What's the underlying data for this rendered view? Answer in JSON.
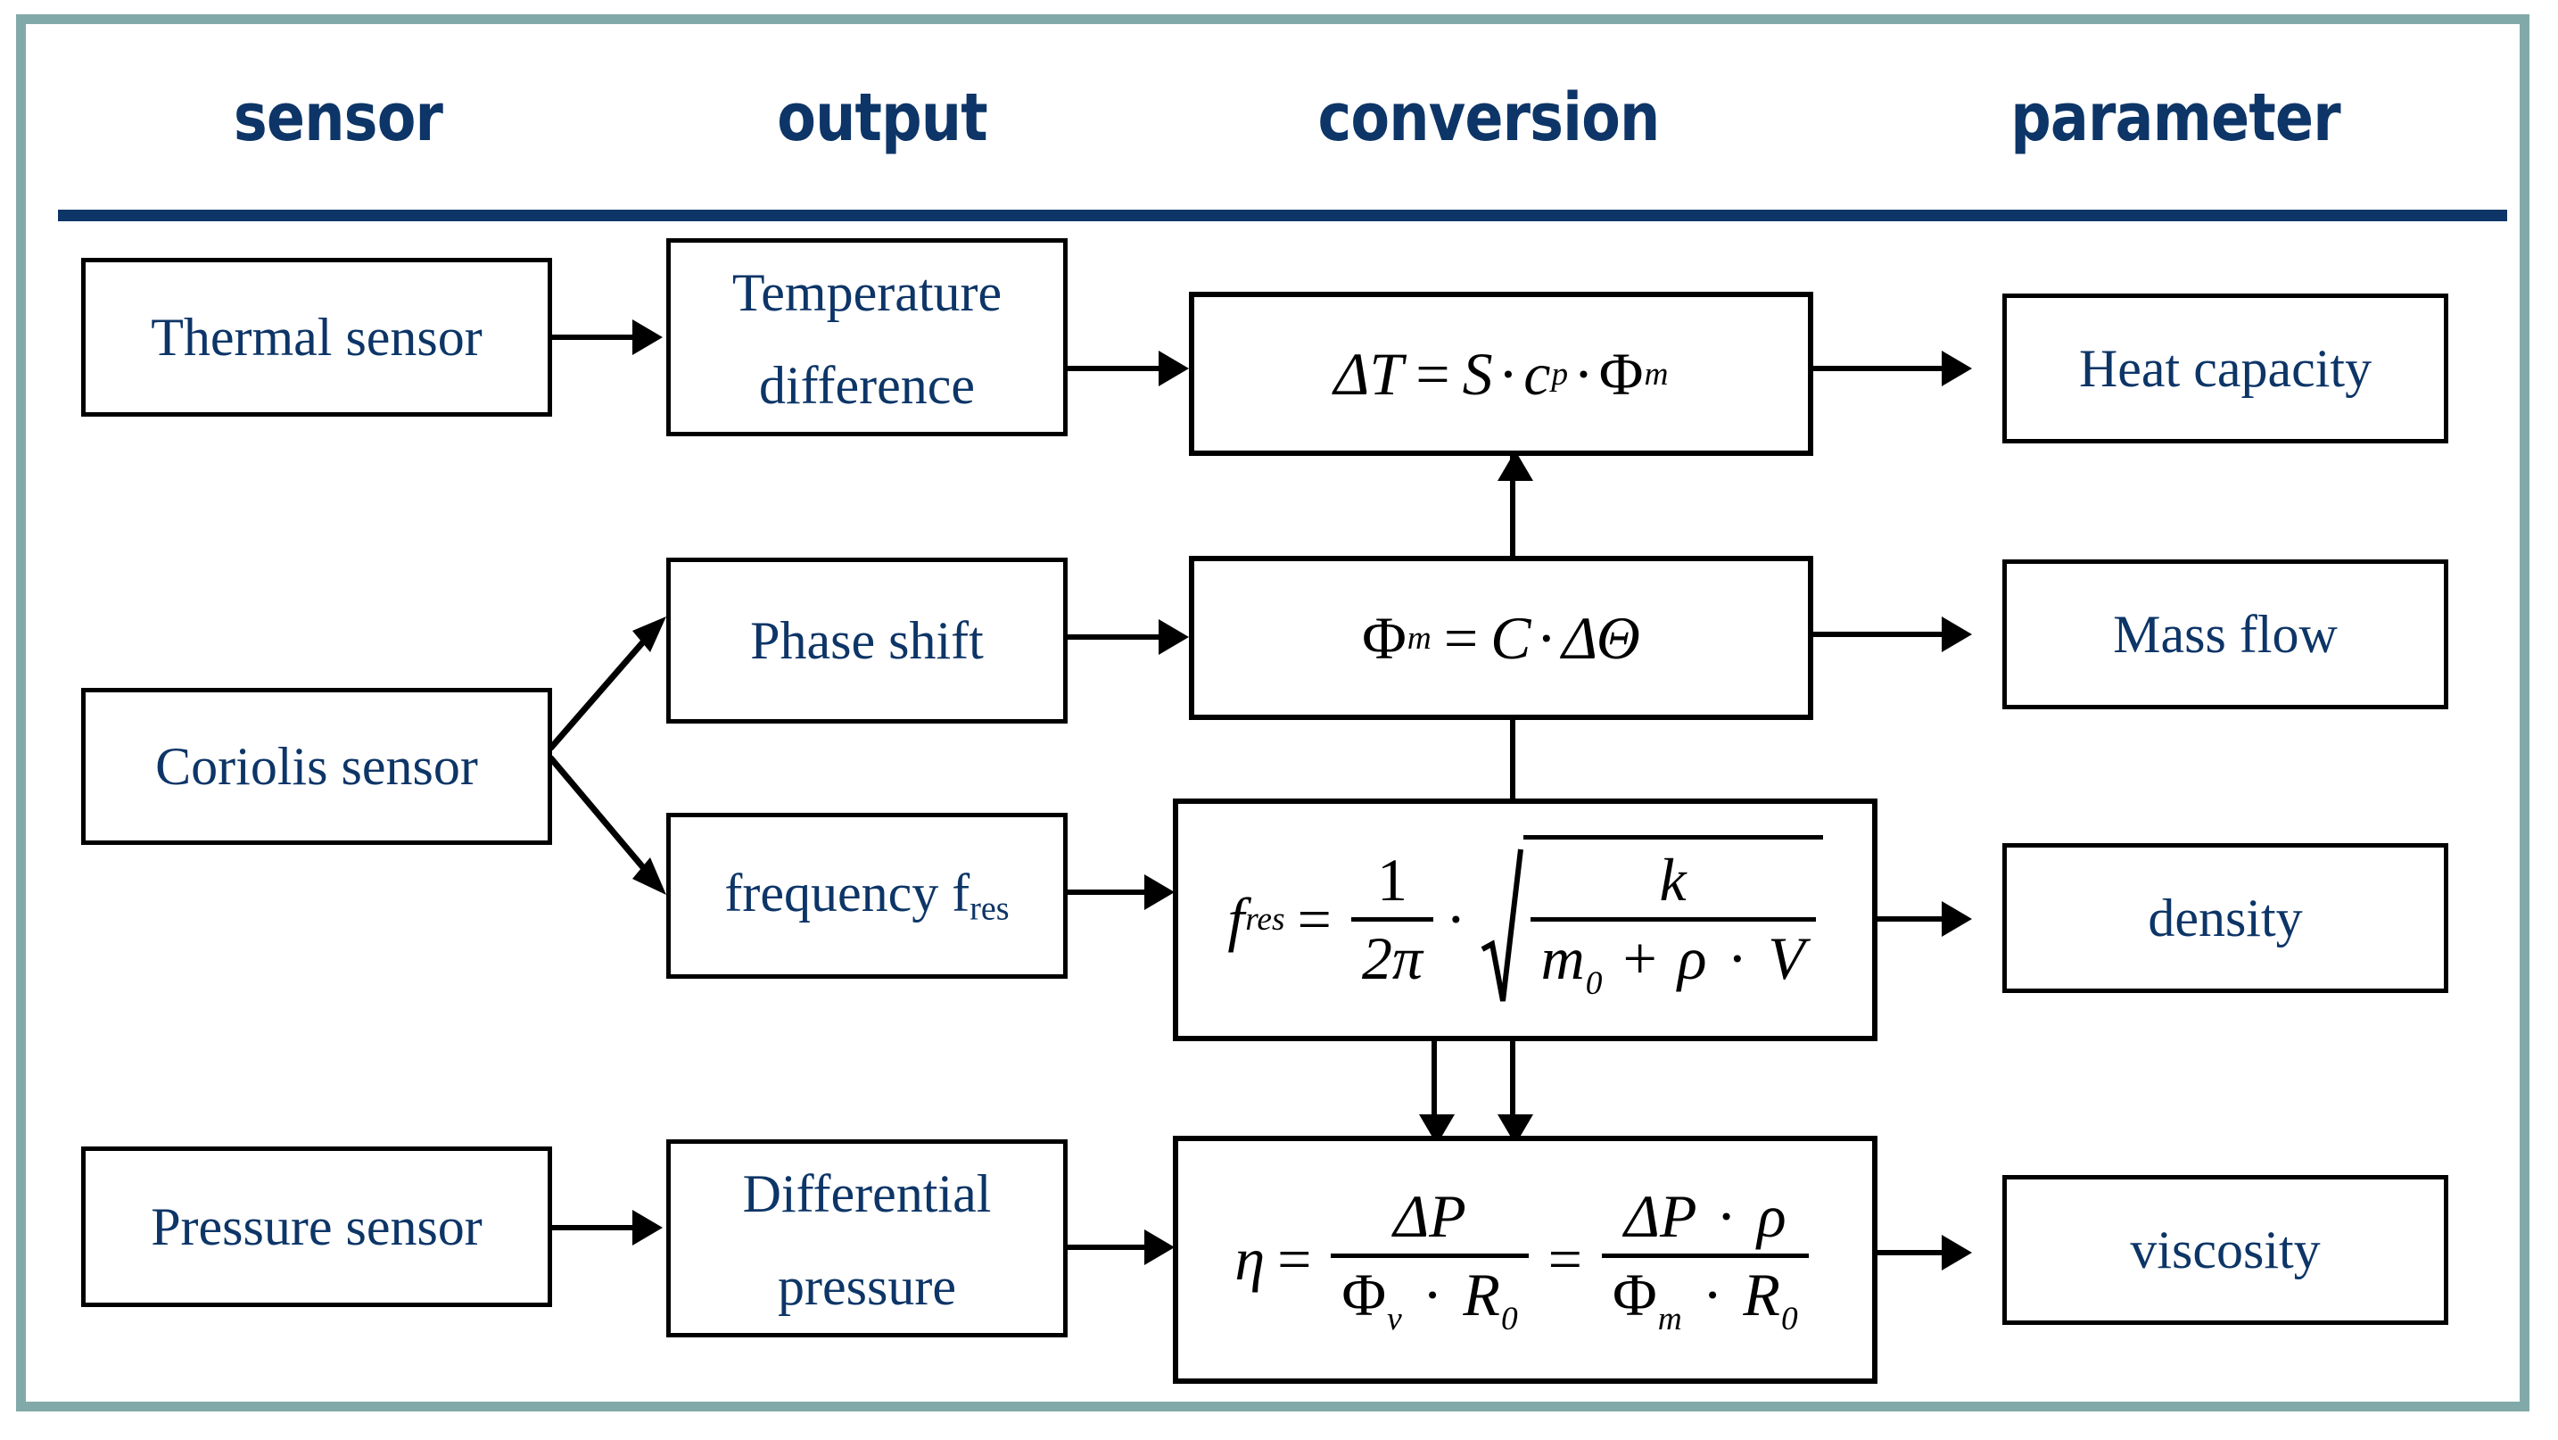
{
  "headers": [
    {
      "label": "sensor"
    },
    {
      "label": "output"
    },
    {
      "label": "conversion"
    },
    {
      "label": "parameter"
    }
  ],
  "colors": {
    "frame": "#82a9a9",
    "header_text": "#0d3567",
    "header_rule": "#0d3567",
    "node_text": "#0d3567",
    "node_border": "#000000",
    "formula_text": "#000000",
    "background": "#ffffff"
  },
  "sensors": [
    {
      "id": "thermal",
      "label": "Thermal sensor"
    },
    {
      "id": "coriolis",
      "label": "Coriolis  sensor"
    },
    {
      "id": "pressure",
      "label": "Pressure sensor"
    }
  ],
  "outputs": [
    {
      "id": "temp-diff",
      "line1": "Temperature",
      "line2": "difference"
    },
    {
      "id": "phase-shift",
      "line1": "Phase shift",
      "line2": ""
    },
    {
      "id": "frequency",
      "line1": "frequency f",
      "sub": "res",
      "line2": ""
    },
    {
      "id": "diff-pressure",
      "line1": "Differential",
      "line2": "pressure"
    }
  ],
  "conversions": [
    {
      "id": "heat-eq",
      "lhs": "ΔT",
      "eq": "=",
      "rhs_1": "S",
      "dot1": "·",
      "rhs_2": "c",
      "rhs_2_sub": "p",
      "dot2": "·",
      "rhs_3": "Φ",
      "rhs_3_sub": "m",
      "plain": "ΔT = S · c_p · Φ_m"
    },
    {
      "id": "massflow-eq",
      "lhs": "Φ",
      "lhs_sub": "m",
      "eq": "=",
      "rhs_1": "C",
      "dot1": "·",
      "rhs_2": "ΔΘ",
      "plain": "Φ_m = C · ΔΘ"
    },
    {
      "id": "fres-eq",
      "lhs": "f",
      "lhs_sub": "res",
      "eq": "=",
      "frac_num": "1",
      "frac_den": "2π",
      "dot1": "·",
      "sqrt_num": "k",
      "sqrt_den_1": "m",
      "sqrt_den_1_sub": "0",
      "sqrt_den_plus": "+",
      "sqrt_den_2": "ρ",
      "sqrt_den_dot": "·",
      "sqrt_den_3": "V",
      "plain": "f_res = (1 / 2π) · √( k / ( m_0 + ρ · V ) )"
    },
    {
      "id": "viscosity-eq",
      "lhs": "η",
      "eq1": "=",
      "f1_num": "ΔP",
      "f1_den_1": "Φ",
      "f1_den_1_sub": "v",
      "f1_den_dot": "·",
      "f1_den_2": "R",
      "f1_den_2_sub": "0",
      "eq2": "=",
      "f2_num_1": "ΔP",
      "f2_num_dot": "·",
      "f2_num_2": "ρ",
      "f2_den_1": "Φ",
      "f2_den_1_sub": "m",
      "f2_den_dot": "·",
      "f2_den_2": "R",
      "f2_den_2_sub": "0",
      "plain": "η = ΔP / (Φ_v · R_0) = (ΔP · ρ) / (Φ_m · R_0)"
    }
  ],
  "parameters": [
    {
      "id": "heat-capacity",
      "label": "Heat capacity"
    },
    {
      "id": "mass-flow",
      "label": "Mass flow"
    },
    {
      "id": "density",
      "label": "density"
    },
    {
      "id": "viscosity",
      "label": "viscosity"
    }
  ],
  "chart_data": {
    "type": "diagram",
    "title": "Sensor output conversion parameter flow",
    "columns": [
      "sensor",
      "output",
      "conversion",
      "parameter"
    ],
    "nodes": [
      {
        "id": "thermal",
        "column": "sensor",
        "text": "Thermal sensor"
      },
      {
        "id": "coriolis",
        "column": "sensor",
        "text": "Coriolis  sensor"
      },
      {
        "id": "pressure",
        "column": "sensor",
        "text": "Pressure sensor"
      },
      {
        "id": "temp-diff",
        "column": "output",
        "text": "Temperature difference"
      },
      {
        "id": "phase-shift",
        "column": "output",
        "text": "Phase shift"
      },
      {
        "id": "frequency",
        "column": "output",
        "text": "frequency f_res"
      },
      {
        "id": "diff-pressure",
        "column": "output",
        "text": "Differential pressure"
      },
      {
        "id": "heat-eq",
        "column": "conversion",
        "text": "ΔT = S · c_p · Φ_m"
      },
      {
        "id": "massflow-eq",
        "column": "conversion",
        "text": "Φ_m = C · ΔΘ"
      },
      {
        "id": "fres-eq",
        "column": "conversion",
        "text": "f_res = (1/2π) · √(k / (m_0 + ρ · V))"
      },
      {
        "id": "viscosity-eq",
        "column": "conversion",
        "text": "η = ΔP/(Φ_v · R_0) = (ΔP · ρ)/(Φ_m · R_0)"
      },
      {
        "id": "heat-capacity",
        "column": "parameter",
        "text": "Heat capacity"
      },
      {
        "id": "mass-flow",
        "column": "parameter",
        "text": "Mass flow"
      },
      {
        "id": "density",
        "column": "parameter",
        "text": "density"
      },
      {
        "id": "viscosity",
        "column": "parameter",
        "text": "viscosity"
      }
    ],
    "edges": [
      {
        "from": "thermal",
        "to": "temp-diff"
      },
      {
        "from": "temp-diff",
        "to": "heat-eq"
      },
      {
        "from": "heat-eq",
        "to": "heat-capacity"
      },
      {
        "from": "coriolis",
        "to": "phase-shift"
      },
      {
        "from": "coriolis",
        "to": "frequency"
      },
      {
        "from": "phase-shift",
        "to": "massflow-eq"
      },
      {
        "from": "massflow-eq",
        "to": "mass-flow"
      },
      {
        "from": "massflow-eq",
        "to": "heat-eq"
      },
      {
        "from": "massflow-eq",
        "to": "viscosity-eq"
      },
      {
        "from": "frequency",
        "to": "fres-eq"
      },
      {
        "from": "fres-eq",
        "to": "density"
      },
      {
        "from": "fres-eq",
        "to": "viscosity-eq"
      },
      {
        "from": "pressure",
        "to": "diff-pressure"
      },
      {
        "from": "diff-pressure",
        "to": "viscosity-eq"
      },
      {
        "from": "viscosity-eq",
        "to": "viscosity"
      }
    ]
  }
}
